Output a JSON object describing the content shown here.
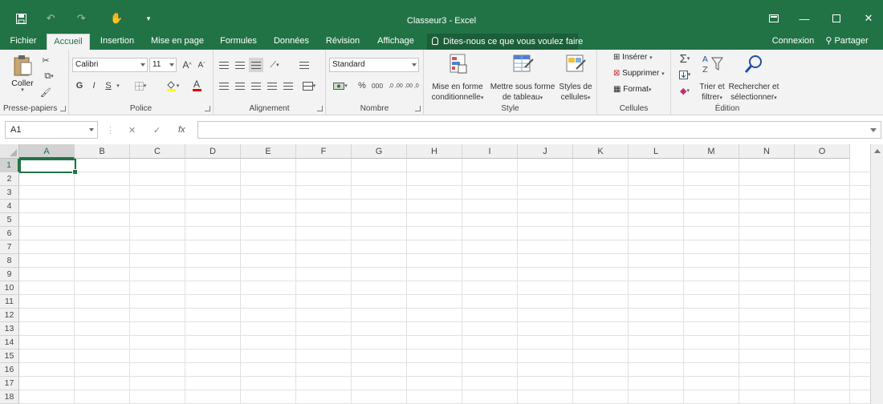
{
  "window": {
    "title": "Classeur3 - Excel"
  },
  "tabs": [
    {
      "label": "Fichier"
    },
    {
      "label": "Accueil"
    },
    {
      "label": "Insertion"
    },
    {
      "label": "Mise en page"
    },
    {
      "label": "Formules"
    },
    {
      "label": "Données"
    },
    {
      "label": "Révision"
    },
    {
      "label": "Affichage"
    }
  ],
  "tell_me": {
    "label": "Dites-nous ce que vous voulez faire"
  },
  "account": {
    "signin": "Connexion",
    "share": "Partager"
  },
  "ribbon": {
    "clipboard": {
      "label": "Presse-papiers",
      "paste": "Coller"
    },
    "font": {
      "label": "Police",
      "name": "Calibri",
      "size": "11",
      "grow": "A",
      "shrink": "A",
      "bold": "G",
      "italic": "I",
      "underline": "S",
      "font_color": "A"
    },
    "alignment": {
      "label": "Alignement"
    },
    "number": {
      "label": "Nombre",
      "format": "Standard",
      "percent": "%",
      "thousands": "000",
      "increase": ",0 ,00",
      "decrease": ",00 ,0"
    },
    "styles": {
      "label": "Style",
      "conditional": [
        "Mise en forme",
        "conditionnelle"
      ],
      "table": [
        "Mettre sous forme",
        "de tableau"
      ],
      "cell_styles": [
        "Styles de",
        "cellules"
      ]
    },
    "cells": {
      "label": "Cellules",
      "insert": "Insérer",
      "delete": "Supprimer",
      "format": "Format"
    },
    "editing": {
      "label": "Édition",
      "sort": [
        "Trier et",
        "filtrer"
      ],
      "find": [
        "Rechercher et",
        "sélectionner"
      ]
    }
  },
  "formula_bar": {
    "name_box": "A1",
    "cancel": "✕",
    "enter": "✓",
    "fx": "fx",
    "value": ""
  },
  "grid": {
    "columns": [
      "A",
      "B",
      "C",
      "D",
      "E",
      "F",
      "G",
      "H",
      "I",
      "J",
      "K",
      "L",
      "M",
      "N",
      "O"
    ],
    "rows": [
      "1",
      "2",
      "3",
      "4",
      "5",
      "6",
      "7",
      "8",
      "9",
      "10",
      "11",
      "12",
      "13",
      "14",
      "15",
      "16",
      "17",
      "18"
    ],
    "active_cell": "A1"
  },
  "colors": {
    "accent": "#217346",
    "ribbon_bg": "#f3f3f3"
  }
}
